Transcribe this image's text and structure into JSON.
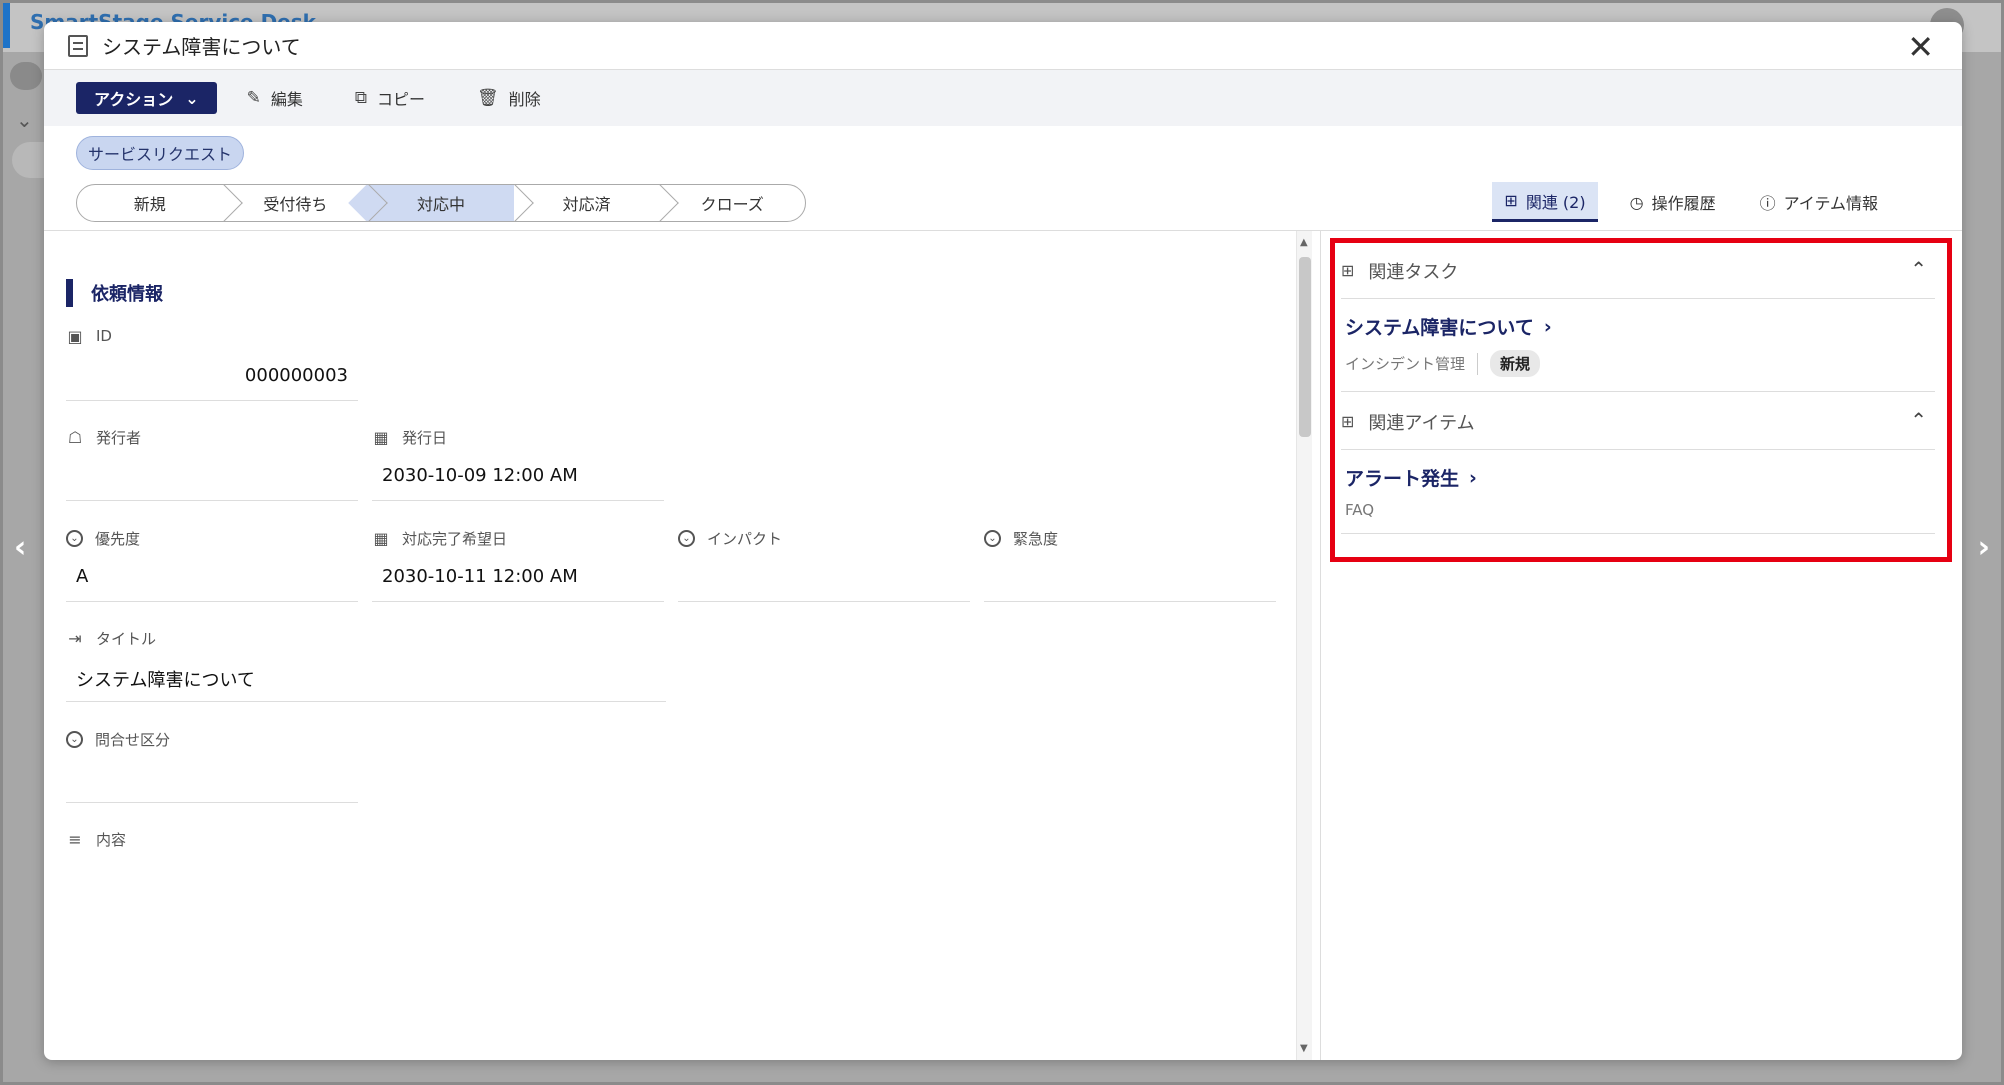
{
  "background": {
    "app_title": "SmartStage Service Desk",
    "nav_prev": "‹",
    "nav_next": "›"
  },
  "modal": {
    "title": "システム障害について",
    "close": "✕"
  },
  "toolbar": {
    "action_label": "アクション",
    "edit_label": "編集",
    "copy_label": "コピー",
    "delete_label": "削除"
  },
  "record_type": "サービスリクエスト",
  "status_steps": [
    {
      "label": "新規"
    },
    {
      "label": "受付待ち"
    },
    {
      "label": "対応中",
      "active": true
    },
    {
      "label": "対応済"
    },
    {
      "label": "クローズ"
    }
  ],
  "right_tabs": {
    "related": "関連 (2)",
    "history": "操作履歴",
    "item_info": "アイテム情報"
  },
  "section": {
    "title": "依頼情報"
  },
  "fields": {
    "id": {
      "label": "ID",
      "value": "000000003"
    },
    "issuer": {
      "label": "発行者",
      "value": ""
    },
    "issue_date": {
      "label": "発行日",
      "value": "2030-10-09 12:00 AM"
    },
    "priority": {
      "label": "優先度",
      "value": "A"
    },
    "desired_date": {
      "label": "対応完了希望日",
      "value": "2030-10-11 12:00 AM"
    },
    "impact": {
      "label": "インパクト",
      "value": ""
    },
    "urgency": {
      "label": "緊急度",
      "value": ""
    },
    "title": {
      "label": "タイトル",
      "value": "システム障害について"
    },
    "inquiry_type": {
      "label": "問合せ区分",
      "value": ""
    },
    "content": {
      "label": "内容",
      "value": ""
    }
  },
  "related_tasks": {
    "header": "関連タスク",
    "items": [
      {
        "title": "システム障害について",
        "category": "インシデント管理",
        "status": "新規"
      }
    ]
  },
  "related_items": {
    "header": "関連アイテム",
    "items": [
      {
        "title": "アラート発生",
        "category": "FAQ"
      }
    ]
  },
  "colors": {
    "primary": "#1b2566",
    "highlight": "#e60012",
    "active_step": "#cfdaf2"
  }
}
